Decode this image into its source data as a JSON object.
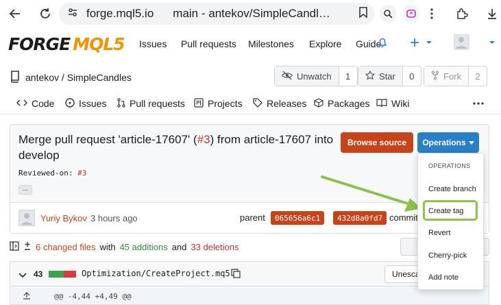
{
  "browser": {
    "host": "forge.mql5.io",
    "tab_title": "main - antekov/SimpleCandles..."
  },
  "header": {
    "logo_forge": "FORGE",
    "logo_mql": "MQL5",
    "nav": [
      "Issues",
      "Pull requests",
      "Milestones",
      "Explore",
      "Guide"
    ]
  },
  "repo": {
    "owner_name": "antekov / SimpleCandles",
    "unwatch_label": "Unwatch",
    "unwatch_count": "1",
    "star_label": "Star",
    "star_count": "0",
    "fork_label": "Fork",
    "fork_count": "2"
  },
  "tabs": [
    "Code",
    "Issues",
    "Pull requests",
    "Projects",
    "Releases",
    "Packages",
    "Wiki"
  ],
  "commit": {
    "title_pre": "Merge pull request 'article-17607' (",
    "title_ref": "#3",
    "title_post": ") from article-17607 into develop",
    "body_label": "Reviewed-on: ",
    "body_ref": "#3",
    "more_label": "...",
    "browse_label": "Browse source",
    "operations_label": "Operations",
    "author": "Yuriy Bykov",
    "time": "3 hours ago",
    "parent_label": "parent",
    "parent_sha": "065656a6c1",
    "commit_sha": "432d8a0fd7",
    "commit_label": "commit"
  },
  "diff": {
    "changed": "6 changed files",
    "with": "with",
    "additions": "45 additions",
    "and": "and",
    "deletions": "33 deletions",
    "file_count": "43",
    "file_path": "Optimization/CreateProject.mq5",
    "unescape_label": "Unesca",
    "hunk": "@@ -4,44 +4,49 @@"
  },
  "operations_menu": {
    "header": "OPERATIONS",
    "items": [
      "Create branch",
      "Create tag",
      "Revert",
      "Cherry-pick",
      "Add note"
    ],
    "highlighted": "Create tag"
  },
  "colors": {
    "accent": "#c7441a",
    "primary": "#2a7fc9",
    "highlight": "#8bc34a"
  }
}
